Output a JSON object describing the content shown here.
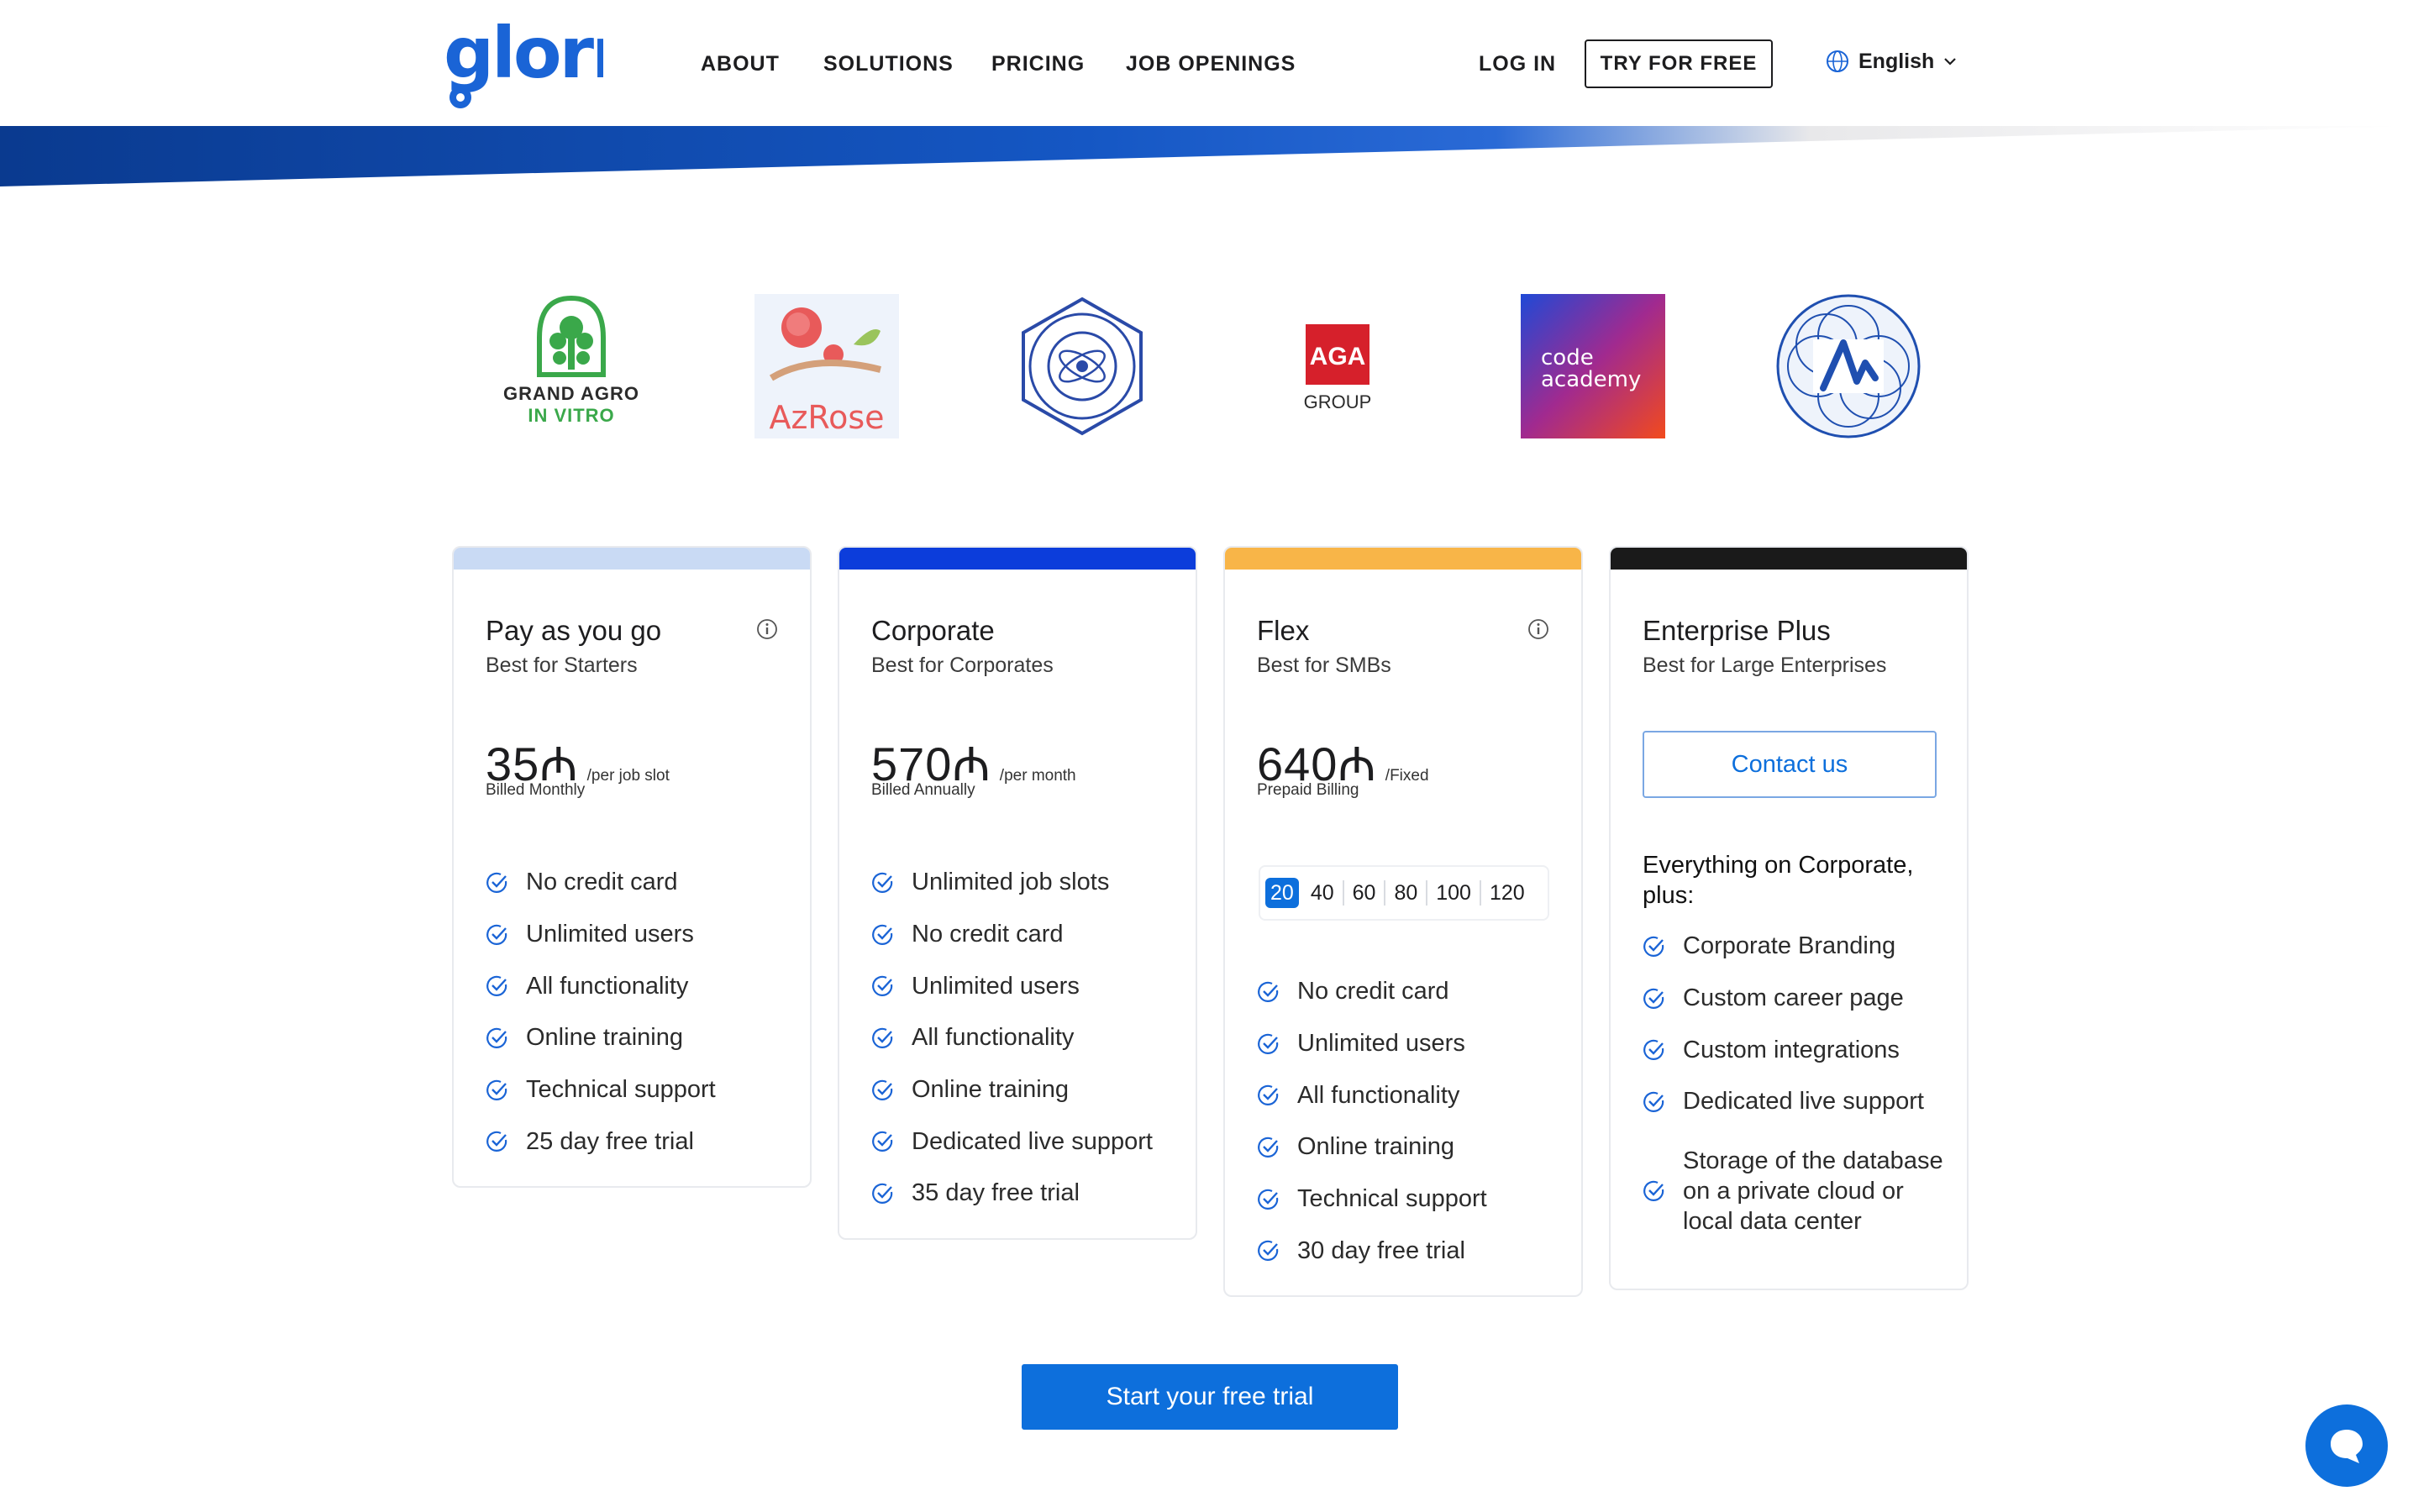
{
  "header": {
    "logo_text": "glorri",
    "nav": [
      "ABOUT",
      "SOLUTIONS",
      "PRICING",
      "JOB OPENINGS"
    ],
    "login": "LOG IN",
    "try_free": "TRY FOR FREE",
    "language": "English"
  },
  "client_logos": [
    {
      "name": "Grand Agro In Vitro",
      "line1": "GRAND AGRO",
      "line2": "IN VITRO"
    },
    {
      "name": "AzRose",
      "text": "AzRose"
    },
    {
      "name": "Geometric atom emblem"
    },
    {
      "name": "AGA Group",
      "line1": "AGA",
      "line2": "GROUP"
    },
    {
      "name": "Code Academy",
      "line1": "code",
      "line2": "academy"
    },
    {
      "name": "Patterned A emblem"
    }
  ],
  "plans": [
    {
      "title": "Pay as you go",
      "subtitle": "Best for Starters",
      "price": "35₼",
      "per": "/per job slot",
      "billing": "Billed Monthly",
      "color": "#c9daf4",
      "features": [
        "No credit card",
        "Unlimited users",
        "All functionality",
        "Online training",
        "Technical support",
        "25 day free trial"
      ]
    },
    {
      "title": "Corporate",
      "subtitle": "Best for Corporates",
      "price": "570₼",
      "per": "/per month",
      "billing": "Billed Annually",
      "color": "#0c3ddb",
      "features": [
        "Unlimited job slots",
        "No credit card",
        "Unlimited users",
        "All functionality",
        "Online training",
        "Dedicated live support",
        "35 day free trial"
      ]
    },
    {
      "title": "Flex",
      "subtitle": "Best for SMBs",
      "price": "640₼",
      "per": "/Fixed",
      "billing": "Prepaid Billing",
      "color": "#f8b548",
      "slot_options": [
        "20",
        "40",
        "60",
        "80",
        "100",
        "120"
      ],
      "selected_slot": "20",
      "features": [
        "No credit card",
        "Unlimited users",
        "All functionality",
        "Online training",
        "Technical support",
        "30 day free trial"
      ]
    },
    {
      "title": "Enterprise Plus",
      "subtitle": "Best for Large Enterprises",
      "color": "#1a1a1a",
      "contact": "Contact us",
      "features_heading": "Everything on Corporate, plus:",
      "features": [
        "Corporate Branding",
        "Custom career page",
        "Custom integrations",
        "Dedicated live support",
        "Storage of the database on a private cloud or local data center"
      ]
    }
  ],
  "cta": "Start your free trial",
  "colors": {
    "brand_blue": "#0d6fdc",
    "logo_blue": "#1a64d6",
    "navy": "#0a3a8f"
  }
}
